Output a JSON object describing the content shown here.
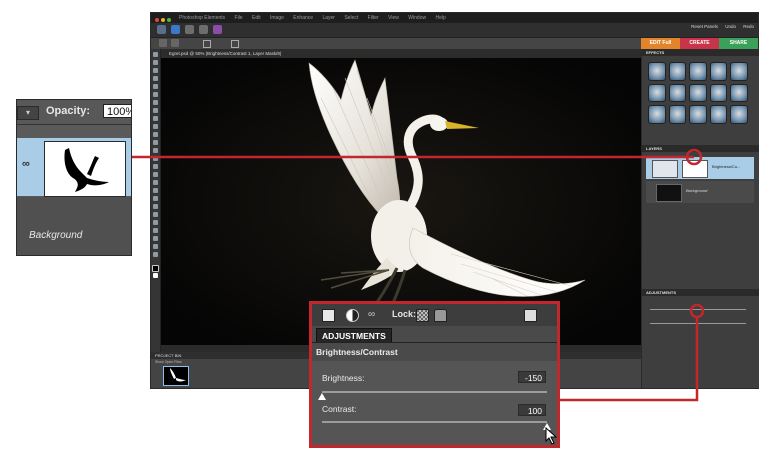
{
  "menubar": {
    "app_name": "Photoshop Elements",
    "items": [
      "File",
      "Edit",
      "Image",
      "Enhance",
      "Layer",
      "Select",
      "Filter",
      "View",
      "Window",
      "Help"
    ],
    "right_items": [
      "Reset Panels",
      "Undo",
      "Redo"
    ]
  },
  "mode_tabs": [
    {
      "label": "EDIT Full",
      "color": "#e2852a"
    },
    {
      "label": "CREATE",
      "color": "#c8344a"
    },
    {
      "label": "SHARE",
      "color": "#3aa05a"
    }
  ],
  "document_tab": {
    "label": "Egret.psd @ 50% (Brightness/Contrast 1, Layer Mask/8)"
  },
  "panels": {
    "effects_header": "EFFECTS",
    "layers_header": "LAYERS",
    "adjustments_header": "ADJUSTMENTS",
    "adjustment_layer_name": "Brightness/Co...",
    "background_layer_name": "Background"
  },
  "project_bin": {
    "header": "PROJECT BIN",
    "subheader": "Show Open Files"
  },
  "zoom_left": {
    "opacity_label": "Opacity:",
    "opacity_value": "100%",
    "background_label": "Background"
  },
  "zoom_bottom": {
    "lock_label": "Lock:",
    "tab_label": "ADJUSTMENTS",
    "panel_title": "Brightness/Contrast",
    "brightness_label": "Brightness:",
    "brightness_value": "-150",
    "contrast_label": "Contrast:",
    "contrast_value": "100"
  },
  "sliders": {
    "brightness_fraction": 0.0,
    "contrast_fraction": 1.0
  },
  "accent_colors": {
    "callout_red": "#c1272d",
    "selection_blue": "#a9cde6"
  }
}
